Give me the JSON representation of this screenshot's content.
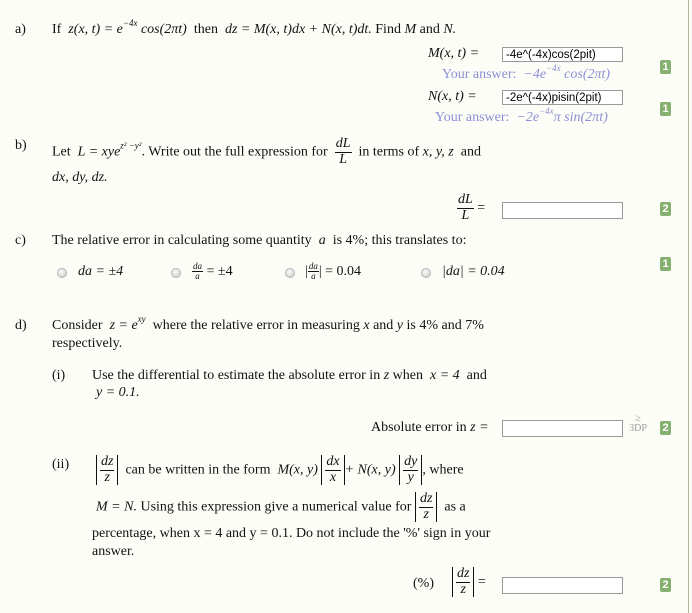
{
  "colors": {
    "badge": "#86b06f",
    "your_answer": "#8b8fd6",
    "background": "#fdfdf7"
  },
  "part_a": {
    "label": "a)",
    "text_if": "If",
    "expr_z": "z(x, t) = e",
    "exp_z": "−4x",
    "expr_cos": " cos(2πt)",
    "text_then": "then",
    "expr_dz": "dz = M(x, t)dx + N(x, t)dt.",
    "text_find": "Find",
    "M": "M",
    "text_and": "and",
    "N": "N.",
    "m_label": "M(x, t) =",
    "m_value": "-4e^(-4x)cos(2pit)",
    "m_your_prefix": "Your answer:",
    "m_your_expr1": "−4e",
    "m_your_exp": "−4x",
    "m_your_expr2": " cos(2πt)",
    "m_badge": "1",
    "n_label": "N(x, t) =",
    "n_value": "-2e^(-4x)pisin(2pit)",
    "n_your_prefix": "Your answer:",
    "n_your_expr1": "−2e",
    "n_your_exp": "−4x",
    "n_your_expr2": "π sin(2πt)",
    "n_badge": "1"
  },
  "part_b": {
    "label": "b)",
    "text_let": "Let",
    "expr_L": "L = xye",
    "exp_L": "z² −y²",
    "text_write": ". Write out the full expression for",
    "frac_num": "dL",
    "frac_den": "L",
    "text_terms": "in terms of",
    "vars": "x, y, z",
    "text_and": "and",
    "line2": "dx, dy, dz.",
    "answer_value": "",
    "badge": "2"
  },
  "part_c": {
    "label": "c)",
    "text1": "The relative error in calculating some quantity",
    "var": "a",
    "text2": "is  4%;  this translates to:",
    "options": [
      {
        "text": "da = ±4"
      },
      {
        "num": "da",
        "den": "a",
        "rest": "= ±4"
      },
      {
        "num": "da",
        "den": "a",
        "rest": "= 0.04"
      },
      {
        "text": "|da| = 0.04"
      }
    ],
    "badge": "1"
  },
  "part_d": {
    "label": "d)",
    "line1_a": "Consider",
    "expr_z": "z = e",
    "exp_z": "xy",
    "line1_b": "where the relative error in measuring",
    "x": "x",
    "and": "and",
    "y": "y",
    "line1_c": "is  4%  and  7%",
    "line2": "respectively.",
    "sub_i": {
      "label": "(i)",
      "text1": "Use the differential to estimate the absolute error in",
      "z": "z",
      "text2": "when",
      "cond1": "x = 4",
      "and": "and",
      "cond2": "y = 0.1.",
      "answer_label": "Absolute error in",
      "answer_z": "z =",
      "answer_value": "",
      "dp_ge": "≥",
      "dp_text": "3DP",
      "badge": "2"
    },
    "sub_ii": {
      "label": "(ii)",
      "frac_num": "dz",
      "frac_den": "z",
      "text1": "can be written in the form",
      "M": "M(x, y)",
      "fx_num": "dx",
      "fx_den": "x",
      "plus_N": "+ N(x, y)",
      "fy_num": "dy",
      "fy_den": "y",
      "text_where": ", where",
      "line2_a": "M = N.",
      "line2_b": "Using this expression give a numerical value for",
      "line2_c": "as a",
      "line3": "percentage, when  x = 4  and  y = 0.1.  Do not include the '%' sign in your",
      "line4": "answer.",
      "answer_prefix": "(%)",
      "answer_eq": "=",
      "answer_value": "",
      "badge": "2"
    }
  }
}
